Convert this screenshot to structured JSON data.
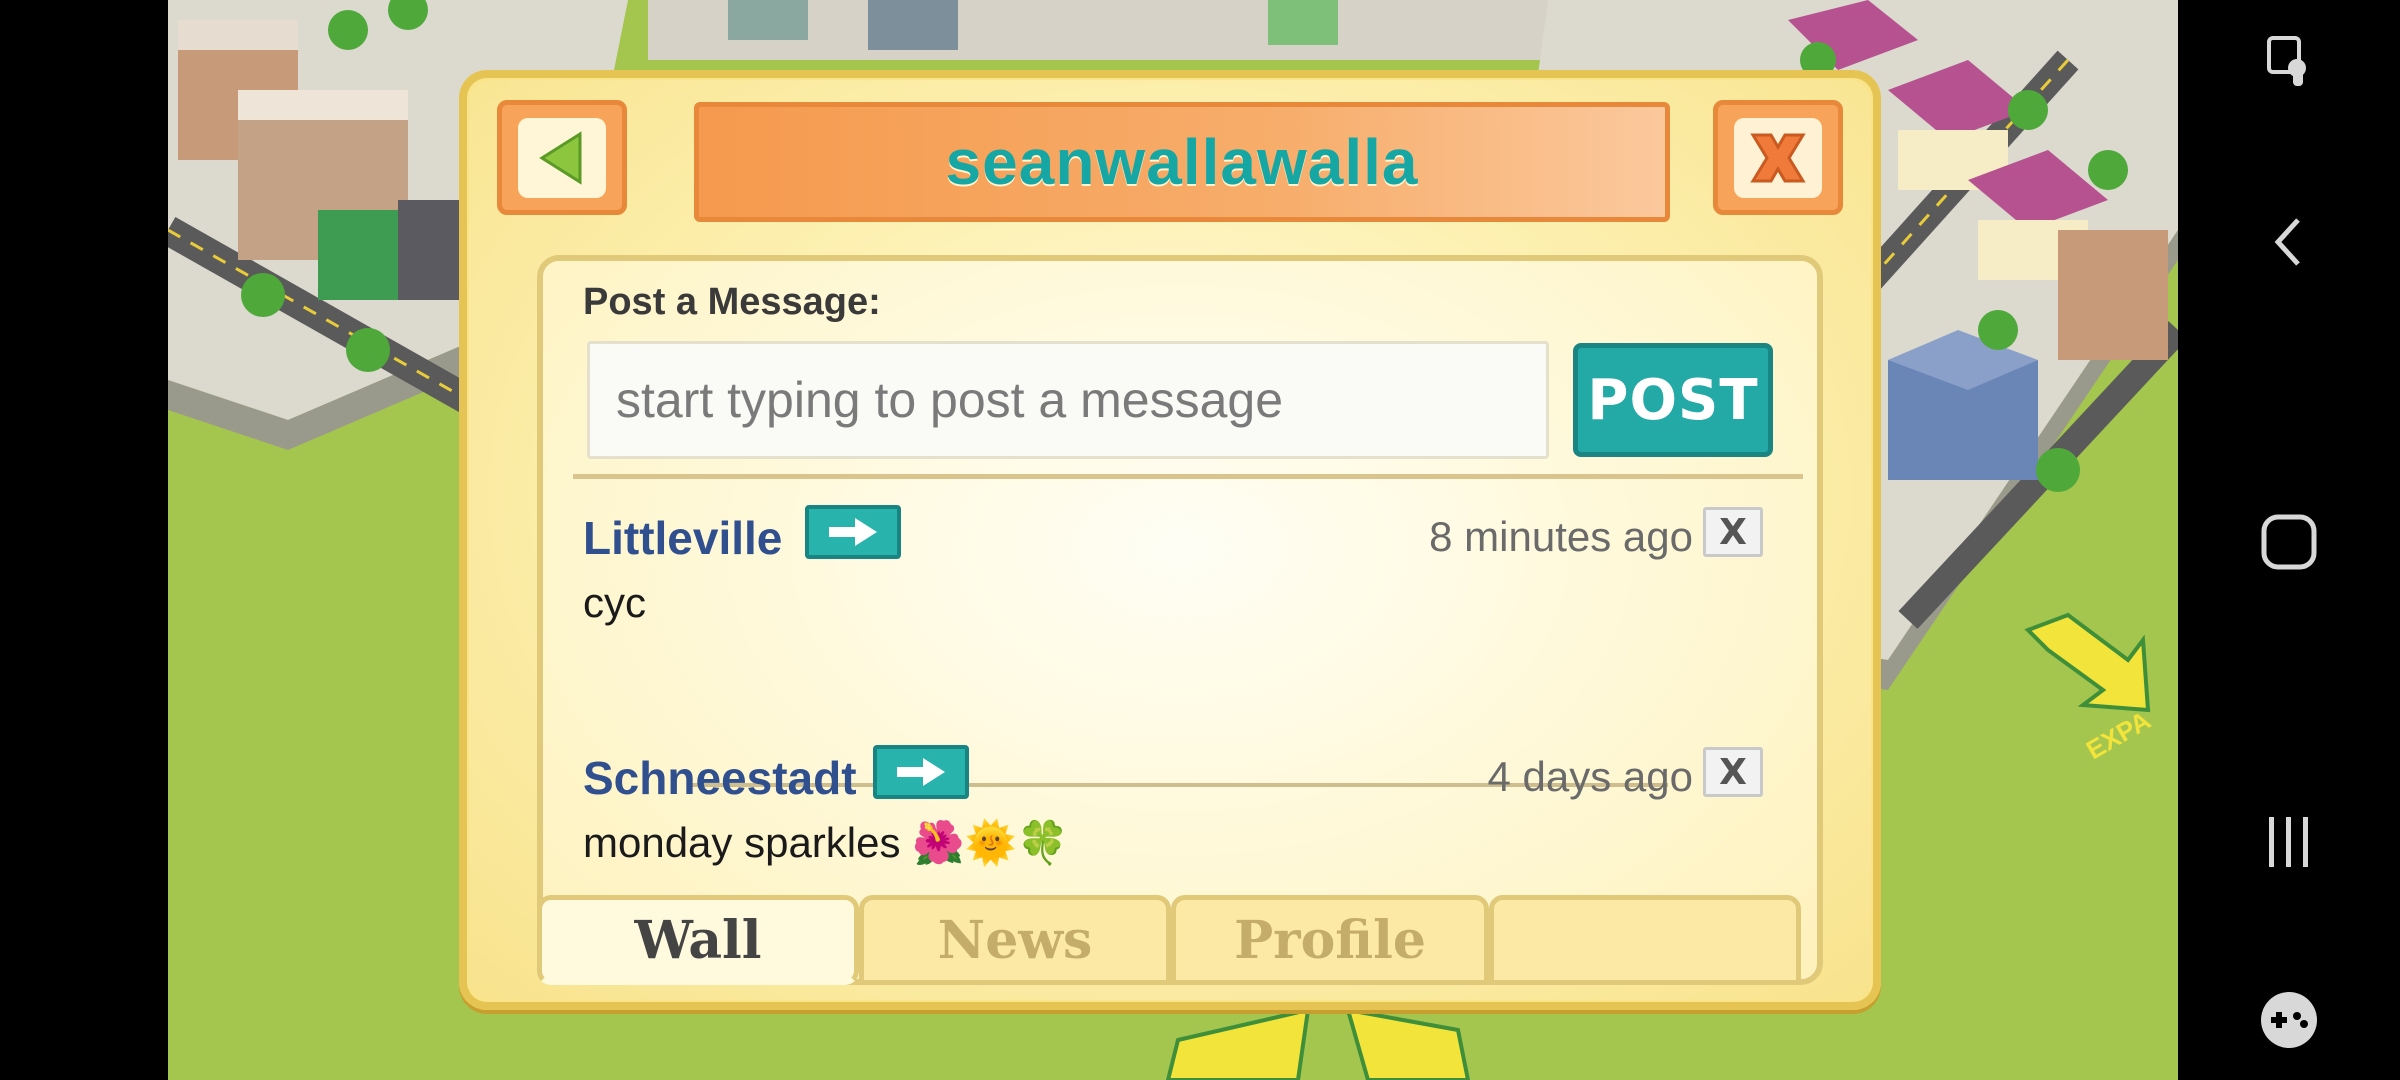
{
  "dialog": {
    "title": "seanwallawalla",
    "back_icon": "left-triangle-icon",
    "close_icon": "close-x-icon"
  },
  "composer": {
    "label": "Post a Message:",
    "placeholder": "start typing to post a message",
    "value": "",
    "post_label": "POST"
  },
  "messages": [
    {
      "author": "Littleville",
      "time": "8 minutes ago",
      "text": "cyc",
      "delete_label": "X"
    },
    {
      "author": "Schneestadt",
      "time": "4 days ago",
      "text": "monday sparkles 🌺🌞🍀",
      "delete_label": "X"
    }
  ],
  "tabs": [
    {
      "label": "Wall",
      "active": true
    },
    {
      "label": "News",
      "active": false
    },
    {
      "label": "Profile",
      "active": false
    },
    {
      "label": "",
      "active": false
    }
  ],
  "scene": {
    "expand_text": "EXPA"
  },
  "navbar": {
    "icons": [
      "screen-lock-icon",
      "back-icon",
      "home-icon",
      "recents-icon",
      "game-controller-icon"
    ]
  },
  "colors": {
    "accent_teal": "#23aaa6",
    "title_orange": "#f59a4e",
    "name_blue": "#2f4f8f",
    "grass": "#a4c64e"
  }
}
